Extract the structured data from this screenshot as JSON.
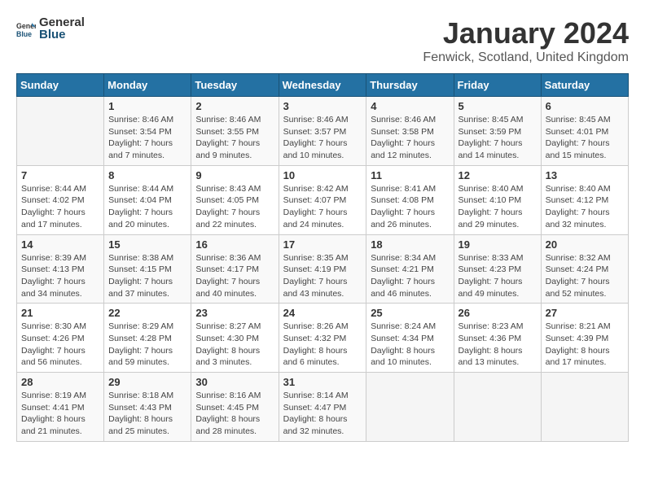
{
  "header": {
    "logo_general": "General",
    "logo_blue": "Blue",
    "title": "January 2024",
    "subtitle": "Fenwick, Scotland, United Kingdom"
  },
  "calendar": {
    "weekdays": [
      "Sunday",
      "Monday",
      "Tuesday",
      "Wednesday",
      "Thursday",
      "Friday",
      "Saturday"
    ],
    "weeks": [
      [
        {
          "day": "",
          "info": ""
        },
        {
          "day": "1",
          "info": "Sunrise: 8:46 AM\nSunset: 3:54 PM\nDaylight: 7 hours\nand 7 minutes."
        },
        {
          "day": "2",
          "info": "Sunrise: 8:46 AM\nSunset: 3:55 PM\nDaylight: 7 hours\nand 9 minutes."
        },
        {
          "day": "3",
          "info": "Sunrise: 8:46 AM\nSunset: 3:57 PM\nDaylight: 7 hours\nand 10 minutes."
        },
        {
          "day": "4",
          "info": "Sunrise: 8:46 AM\nSunset: 3:58 PM\nDaylight: 7 hours\nand 12 minutes."
        },
        {
          "day": "5",
          "info": "Sunrise: 8:45 AM\nSunset: 3:59 PM\nDaylight: 7 hours\nand 14 minutes."
        },
        {
          "day": "6",
          "info": "Sunrise: 8:45 AM\nSunset: 4:01 PM\nDaylight: 7 hours\nand 15 minutes."
        }
      ],
      [
        {
          "day": "7",
          "info": "Sunrise: 8:44 AM\nSunset: 4:02 PM\nDaylight: 7 hours\nand 17 minutes."
        },
        {
          "day": "8",
          "info": "Sunrise: 8:44 AM\nSunset: 4:04 PM\nDaylight: 7 hours\nand 20 minutes."
        },
        {
          "day": "9",
          "info": "Sunrise: 8:43 AM\nSunset: 4:05 PM\nDaylight: 7 hours\nand 22 minutes."
        },
        {
          "day": "10",
          "info": "Sunrise: 8:42 AM\nSunset: 4:07 PM\nDaylight: 7 hours\nand 24 minutes."
        },
        {
          "day": "11",
          "info": "Sunrise: 8:41 AM\nSunset: 4:08 PM\nDaylight: 7 hours\nand 26 minutes."
        },
        {
          "day": "12",
          "info": "Sunrise: 8:40 AM\nSunset: 4:10 PM\nDaylight: 7 hours\nand 29 minutes."
        },
        {
          "day": "13",
          "info": "Sunrise: 8:40 AM\nSunset: 4:12 PM\nDaylight: 7 hours\nand 32 minutes."
        }
      ],
      [
        {
          "day": "14",
          "info": "Sunrise: 8:39 AM\nSunset: 4:13 PM\nDaylight: 7 hours\nand 34 minutes."
        },
        {
          "day": "15",
          "info": "Sunrise: 8:38 AM\nSunset: 4:15 PM\nDaylight: 7 hours\nand 37 minutes."
        },
        {
          "day": "16",
          "info": "Sunrise: 8:36 AM\nSunset: 4:17 PM\nDaylight: 7 hours\nand 40 minutes."
        },
        {
          "day": "17",
          "info": "Sunrise: 8:35 AM\nSunset: 4:19 PM\nDaylight: 7 hours\nand 43 minutes."
        },
        {
          "day": "18",
          "info": "Sunrise: 8:34 AM\nSunset: 4:21 PM\nDaylight: 7 hours\nand 46 minutes."
        },
        {
          "day": "19",
          "info": "Sunrise: 8:33 AM\nSunset: 4:23 PM\nDaylight: 7 hours\nand 49 minutes."
        },
        {
          "day": "20",
          "info": "Sunrise: 8:32 AM\nSunset: 4:24 PM\nDaylight: 7 hours\nand 52 minutes."
        }
      ],
      [
        {
          "day": "21",
          "info": "Sunrise: 8:30 AM\nSunset: 4:26 PM\nDaylight: 7 hours\nand 56 minutes."
        },
        {
          "day": "22",
          "info": "Sunrise: 8:29 AM\nSunset: 4:28 PM\nDaylight: 7 hours\nand 59 minutes."
        },
        {
          "day": "23",
          "info": "Sunrise: 8:27 AM\nSunset: 4:30 PM\nDaylight: 8 hours\nand 3 minutes."
        },
        {
          "day": "24",
          "info": "Sunrise: 8:26 AM\nSunset: 4:32 PM\nDaylight: 8 hours\nand 6 minutes."
        },
        {
          "day": "25",
          "info": "Sunrise: 8:24 AM\nSunset: 4:34 PM\nDaylight: 8 hours\nand 10 minutes."
        },
        {
          "day": "26",
          "info": "Sunrise: 8:23 AM\nSunset: 4:36 PM\nDaylight: 8 hours\nand 13 minutes."
        },
        {
          "day": "27",
          "info": "Sunrise: 8:21 AM\nSunset: 4:39 PM\nDaylight: 8 hours\nand 17 minutes."
        }
      ],
      [
        {
          "day": "28",
          "info": "Sunrise: 8:19 AM\nSunset: 4:41 PM\nDaylight: 8 hours\nand 21 minutes."
        },
        {
          "day": "29",
          "info": "Sunrise: 8:18 AM\nSunset: 4:43 PM\nDaylight: 8 hours\nand 25 minutes."
        },
        {
          "day": "30",
          "info": "Sunrise: 8:16 AM\nSunset: 4:45 PM\nDaylight: 8 hours\nand 28 minutes."
        },
        {
          "day": "31",
          "info": "Sunrise: 8:14 AM\nSunset: 4:47 PM\nDaylight: 8 hours\nand 32 minutes."
        },
        {
          "day": "",
          "info": ""
        },
        {
          "day": "",
          "info": ""
        },
        {
          "day": "",
          "info": ""
        }
      ]
    ]
  }
}
